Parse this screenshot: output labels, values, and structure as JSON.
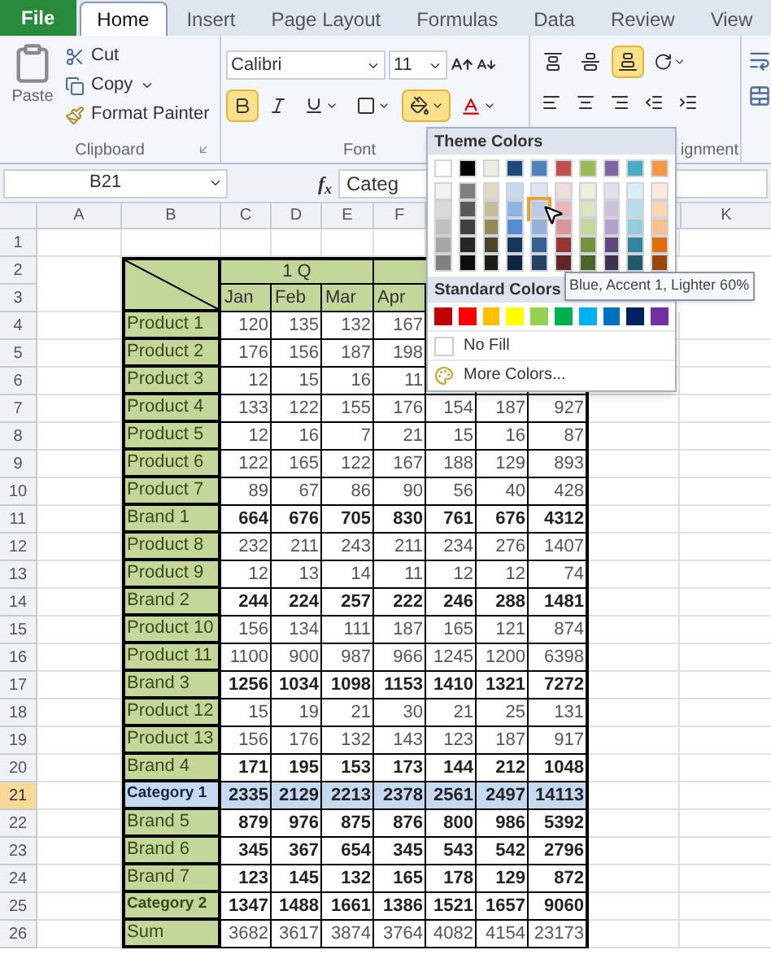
{
  "ribbon": {
    "tabs": [
      {
        "label": "File",
        "kind": "file",
        "selected": false
      },
      {
        "label": "Home",
        "kind": "tab",
        "selected": true
      },
      {
        "label": "Insert",
        "kind": "tab",
        "selected": false
      },
      {
        "label": "Page Layout",
        "kind": "tab",
        "selected": false
      },
      {
        "label": "Formulas",
        "kind": "tab",
        "selected": false
      },
      {
        "label": "Data",
        "kind": "tab",
        "selected": false
      },
      {
        "label": "Review",
        "kind": "tab",
        "selected": false
      },
      {
        "label": "View",
        "kind": "tab",
        "selected": false
      }
    ],
    "clipboard": {
      "paste": "Paste",
      "cut": "Cut",
      "copy": "Copy",
      "format_painter": "Format Painter",
      "label": "Clipboard"
    },
    "font": {
      "name": "Calibri",
      "size": "11",
      "label": "Font",
      "bold_selected": true,
      "fill_selected": true
    },
    "alignment": {
      "label": "ignment",
      "bottom_align_selected": true
    }
  },
  "formula_bar": {
    "name_box": "B21",
    "function_label": "f$_{x}$",
    "content": "Categ"
  },
  "sheet": {
    "columns_left": [
      "A",
      "B",
      "C",
      "D",
      "E",
      "F"
    ],
    "columns_right": [
      "K"
    ],
    "row_numbers": [
      "1",
      "2",
      "3",
      "4",
      "5",
      "6",
      "7",
      "8",
      "9",
      "10",
      "11",
      "12",
      "13",
      "14",
      "15",
      "16",
      "17",
      "18",
      "19",
      "20",
      "21",
      "22",
      "23",
      "24",
      "25",
      "26"
    ],
    "quarter": "1 Q",
    "months": [
      "Jan",
      "Feb",
      "Mar",
      "Apr"
    ],
    "rows": [
      {
        "label": "Product 1",
        "kind": "product",
        "selected": false,
        "values": [
          "120",
          "135",
          "132",
          "167"
        ]
      },
      {
        "label": "Product 2",
        "kind": "product",
        "selected": false,
        "values": [
          "176",
          "156",
          "187",
          "198"
        ]
      },
      {
        "label": "Product 3",
        "kind": "product",
        "selected": false,
        "values": [
          "12",
          "15",
          "16",
          "11"
        ]
      },
      {
        "label": "Product 4",
        "kind": "product",
        "selected": false,
        "values": [
          "133",
          "122",
          "155",
          "176",
          "154",
          "187",
          "927"
        ]
      },
      {
        "label": "Product 5",
        "kind": "product",
        "selected": false,
        "values": [
          "12",
          "16",
          "7",
          "21",
          "15",
          "16",
          "87"
        ]
      },
      {
        "label": "Product 6",
        "kind": "product",
        "selected": false,
        "values": [
          "122",
          "165",
          "122",
          "167",
          "188",
          "129",
          "893"
        ]
      },
      {
        "label": "Product 7",
        "kind": "product",
        "selected": false,
        "values": [
          "89",
          "67",
          "86",
          "90",
          "56",
          "40",
          "428"
        ]
      },
      {
        "label": "Brand 1",
        "kind": "brand",
        "selected": false,
        "values": [
          "664",
          "676",
          "705",
          "830",
          "761",
          "676",
          "4312"
        ]
      },
      {
        "label": "Product 8",
        "kind": "product",
        "selected": false,
        "values": [
          "232",
          "211",
          "243",
          "211",
          "234",
          "276",
          "1407"
        ]
      },
      {
        "label": "Product 9",
        "kind": "product",
        "selected": false,
        "values": [
          "12",
          "13",
          "14",
          "11",
          "12",
          "12",
          "74"
        ]
      },
      {
        "label": "Brand 2",
        "kind": "brand",
        "selected": false,
        "values": [
          "244",
          "224",
          "257",
          "222",
          "246",
          "288",
          "1481"
        ]
      },
      {
        "label": "Product 10",
        "kind": "product",
        "selected": false,
        "values": [
          "156",
          "134",
          "111",
          "187",
          "165",
          "121",
          "874"
        ]
      },
      {
        "label": "Product 11",
        "kind": "product",
        "selected": false,
        "values": [
          "1100",
          "900",
          "987",
          "966",
          "1245",
          "1200",
          "6398"
        ]
      },
      {
        "label": "Brand 3",
        "kind": "brand",
        "selected": false,
        "values": [
          "1256",
          "1034",
          "1098",
          "1153",
          "1410",
          "1321",
          "7272"
        ]
      },
      {
        "label": "Product 12",
        "kind": "product",
        "selected": false,
        "values": [
          "15",
          "19",
          "21",
          "30",
          "21",
          "25",
          "131"
        ]
      },
      {
        "label": "Product 13",
        "kind": "product",
        "selected": false,
        "values": [
          "156",
          "176",
          "132",
          "143",
          "123",
          "187",
          "917"
        ]
      },
      {
        "label": "Brand 4",
        "kind": "brand",
        "selected": false,
        "values": [
          "171",
          "195",
          "153",
          "173",
          "144",
          "212",
          "1048"
        ]
      },
      {
        "label": "Category 1",
        "kind": "category",
        "selected": true,
        "values": [
          "2335",
          "2129",
          "2213",
          "2378",
          "2561",
          "2497",
          "14113"
        ]
      },
      {
        "label": "Brand 5",
        "kind": "brand",
        "selected": false,
        "values": [
          "879",
          "976",
          "875",
          "876",
          "800",
          "986",
          "5392"
        ]
      },
      {
        "label": "Brand 6",
        "kind": "brand",
        "selected": false,
        "values": [
          "345",
          "367",
          "654",
          "345",
          "543",
          "542",
          "2796"
        ]
      },
      {
        "label": "Brand 7",
        "kind": "brand",
        "selected": false,
        "values": [
          "123",
          "145",
          "132",
          "165",
          "178",
          "129",
          "872"
        ]
      },
      {
        "label": "Category 2",
        "kind": "category",
        "selected": false,
        "values": [
          "1347",
          "1488",
          "1661",
          "1386",
          "1521",
          "1657",
          "9060"
        ]
      },
      {
        "label": "Sum",
        "kind": "sum",
        "selected": false,
        "values": [
          "3682",
          "3617",
          "3874",
          "3764",
          "4082",
          "4154",
          "23173"
        ]
      }
    ]
  },
  "color_menu": {
    "theme_title": "Theme Colors",
    "theme_colors": [
      [
        {
          "color": "#ffffff",
          "selected": false
        },
        {
          "color": "#000000",
          "selected": false
        },
        {
          "color": "#eeece1",
          "selected": false
        },
        {
          "color": "#1f497d",
          "selected": false
        },
        {
          "color": "#4f81bd",
          "selected": false
        },
        {
          "color": "#c0504d",
          "selected": false
        },
        {
          "color": "#9bbb59",
          "selected": false
        },
        {
          "color": "#8064a2",
          "selected": false
        },
        {
          "color": "#4bacc6",
          "selected": false
        },
        {
          "color": "#f79646",
          "selected": false
        }
      ],
      [
        {
          "color": "#f2f2f2",
          "selected": false
        },
        {
          "color": "#7f7f7f",
          "selected": false
        },
        {
          "color": "#ddd9c4",
          "selected": false
        },
        {
          "color": "#c6d9f1",
          "selected": false
        },
        {
          "color": "#dce6f1",
          "selected": false
        },
        {
          "color": "#f2dcdb",
          "selected": false
        },
        {
          "color": "#ebf1de",
          "selected": false
        },
        {
          "color": "#e4dfec",
          "selected": false
        },
        {
          "color": "#daeef3",
          "selected": false
        },
        {
          "color": "#fde9d9",
          "selected": false
        }
      ],
      [
        {
          "color": "#d9d9d9",
          "selected": false
        },
        {
          "color": "#595959",
          "selected": false
        },
        {
          "color": "#c4bd97",
          "selected": false
        },
        {
          "color": "#8db4e2",
          "selected": false
        },
        {
          "color": "#b8cce4",
          "selected": true
        },
        {
          "color": "#e6b8b7",
          "selected": false
        },
        {
          "color": "#d8e4bc",
          "selected": false
        },
        {
          "color": "#ccc0da",
          "selected": false
        },
        {
          "color": "#b7dee8",
          "selected": false
        },
        {
          "color": "#fcd5b4",
          "selected": false
        }
      ],
      [
        {
          "color": "#bfbfbf",
          "selected": false
        },
        {
          "color": "#404040",
          "selected": false
        },
        {
          "color": "#948a54",
          "selected": false
        },
        {
          "color": "#538dd5",
          "selected": false
        },
        {
          "color": "#95b3d7",
          "selected": false
        },
        {
          "color": "#da9694",
          "selected": false
        },
        {
          "color": "#c4d79b",
          "selected": false
        },
        {
          "color": "#b1a0c7",
          "selected": false
        },
        {
          "color": "#92cddc",
          "selected": false
        },
        {
          "color": "#fabf8f",
          "selected": false
        }
      ],
      [
        {
          "color": "#a6a6a6",
          "selected": false
        },
        {
          "color": "#262626",
          "selected": false
        },
        {
          "color": "#4a452a",
          "selected": false
        },
        {
          "color": "#16365c",
          "selected": false
        },
        {
          "color": "#366092",
          "selected": false
        },
        {
          "color": "#963634",
          "selected": false
        },
        {
          "color": "#76933c",
          "selected": false
        },
        {
          "color": "#60497a",
          "selected": false
        },
        {
          "color": "#31869b",
          "selected": false
        },
        {
          "color": "#e26b0a",
          "selected": false
        }
      ],
      [
        {
          "color": "#808080",
          "selected": false
        },
        {
          "color": "#0d0d0d",
          "selected": false
        },
        {
          "color": "#1e1c11",
          "selected": false
        },
        {
          "color": "#0f243e",
          "selected": false
        },
        {
          "color": "#244062",
          "selected": false
        },
        {
          "color": "#632523",
          "selected": false
        },
        {
          "color": "#4f6228",
          "selected": false
        },
        {
          "color": "#403151",
          "selected": false
        },
        {
          "color": "#215967",
          "selected": false
        },
        {
          "color": "#974706",
          "selected": false
        }
      ]
    ],
    "standard_title": "Standard Colors",
    "standard_colors": [
      {
        "color": "#c00000"
      },
      {
        "color": "#ff0000"
      },
      {
        "color": "#ffc000"
      },
      {
        "color": "#ffff00"
      },
      {
        "color": "#92d050"
      },
      {
        "color": "#00b050"
      },
      {
        "color": "#00b0f0"
      },
      {
        "color": "#0070c0"
      },
      {
        "color": "#002060"
      },
      {
        "color": "#7030a0"
      }
    ],
    "no_fill": "No Fill",
    "more_colors": "More Colors...",
    "tooltip": "Blue, Accent 1, Lighter 60%"
  }
}
